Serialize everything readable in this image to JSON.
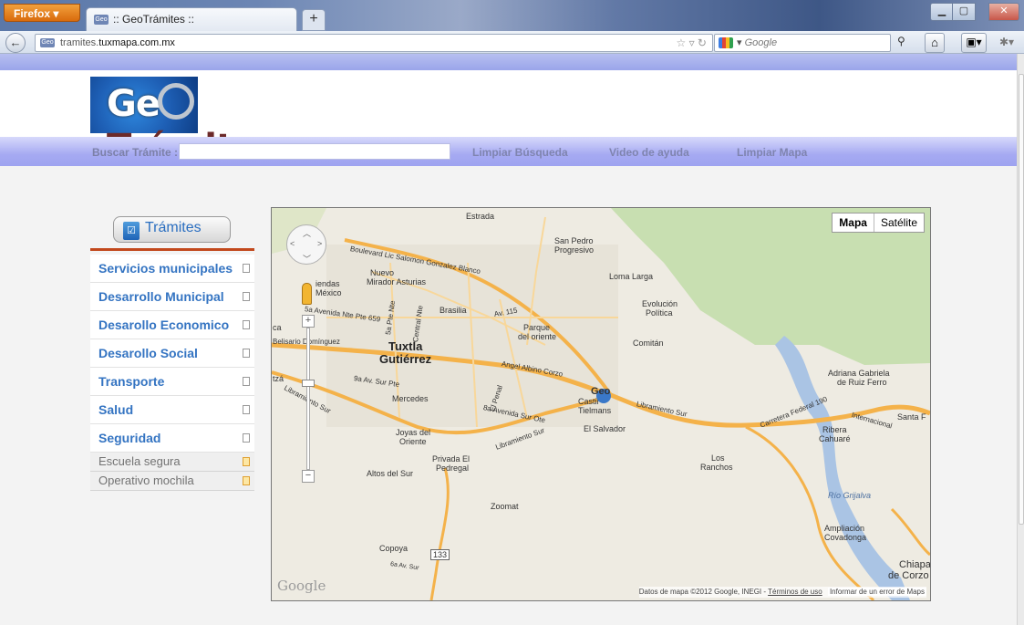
{
  "browser": {
    "app_button": "Firefox",
    "tab_title": ":: GeoTrámites ::",
    "new_tab": "+",
    "url_prefix": "tramites.",
    "url_host": "tuxmapa.com.mx",
    "search_placeholder": "Google"
  },
  "header": {
    "logo_part1": "Ge",
    "logo_part2": "Trámites"
  },
  "toolbar": {
    "search_label": "Buscar Trámite :",
    "search_value": "",
    "clear_search": "Limpiar Búsqueda",
    "help_video": "Video de ayuda",
    "clear_map": "Limpiar Mapa"
  },
  "sidebar": {
    "title": "Trámites",
    "items": [
      {
        "label": "Servicios municipales"
      },
      {
        "label": "Desarrollo Municipal"
      },
      {
        "label": "Desarollo Economico"
      },
      {
        "label": "Desarollo Social"
      },
      {
        "label": "Transporte"
      },
      {
        "label": "Salud"
      },
      {
        "label": "Seguridad"
      }
    ],
    "sub_items": [
      {
        "label": "Escuela segura"
      },
      {
        "label": "Operativo mochila"
      }
    ]
  },
  "map": {
    "type_map": "Mapa",
    "type_satellite": "Satélite",
    "google_logo": "Google",
    "attribution": "Datos de mapa ©2012 Google, INEGI -",
    "terms": "Términos de uso",
    "report": "Informar de un error de Maps",
    "marker_label": "Geo",
    "labels": {
      "estrada": "Estrada",
      "san_pedro": "San Pedro",
      "progresivo": "Progresivo",
      "loma_larga": "Loma Larga",
      "evolucion": "Evolución",
      "politica": "Política",
      "nuevo": "Nuevo",
      "mirador": "Mirador Asturias",
      "haciendas": "iendas",
      "mexico": "México",
      "brasilia": "Brasilia",
      "parque": "Parque",
      "del_oriente": "del oriente",
      "comitan": "Comitán",
      "tuxtla": "Tuxtla",
      "gutierrez": "Gutiérrez",
      "mercedes": "Mercedes",
      "castillo": "Castil",
      "tielmans": "Tielmans",
      "el_salvador": "El Salvador",
      "joyas": "Joyas del",
      "oriente": "Oriente",
      "privada": "Privada El",
      "pedregal": "Pedregal",
      "altos": "Altos del Sur",
      "los": "Los",
      "ranchos": "Ranchos",
      "zoomat": "Zoomat",
      "copoya": "Copoya",
      "route133": "133",
      "adriana": "Adriana Gabriela",
      "ruiz": "de Ruiz Ferro",
      "ribera": "Ribera",
      "cahuare": "Cahuaré",
      "santa": "Santa F",
      "rio": "Río Grijalva",
      "ampliacion": "Ampliación",
      "covadonga": "Covadonga",
      "chiapa": "Chiapa",
      "de_corzo": "de Corzo",
      "ca": "ca",
      "tza": "tzá",
      "belisario": "Belisario Domínguez",
      "blvd": "Boulevard Lic Salomon Gonzalez Blanco",
      "ave_nte": "5a Avenida Nte Pte 659",
      "ave_sur": "9a Av. Sur Pte",
      "libramiento": "Libramiento Sur",
      "angel": "Angel Albino Corzo",
      "sur_ote": "8a Avenida Sur Ote",
      "av115": "Av. 115",
      "internacional": "Internacional",
      "carretera": "Carretera Federal 190",
      "el_penal": "El Penal",
      "central": "Central Nte",
      "sa_pte": "5a Pte Nte",
      "av6": "6a Av. Sur"
    }
  }
}
